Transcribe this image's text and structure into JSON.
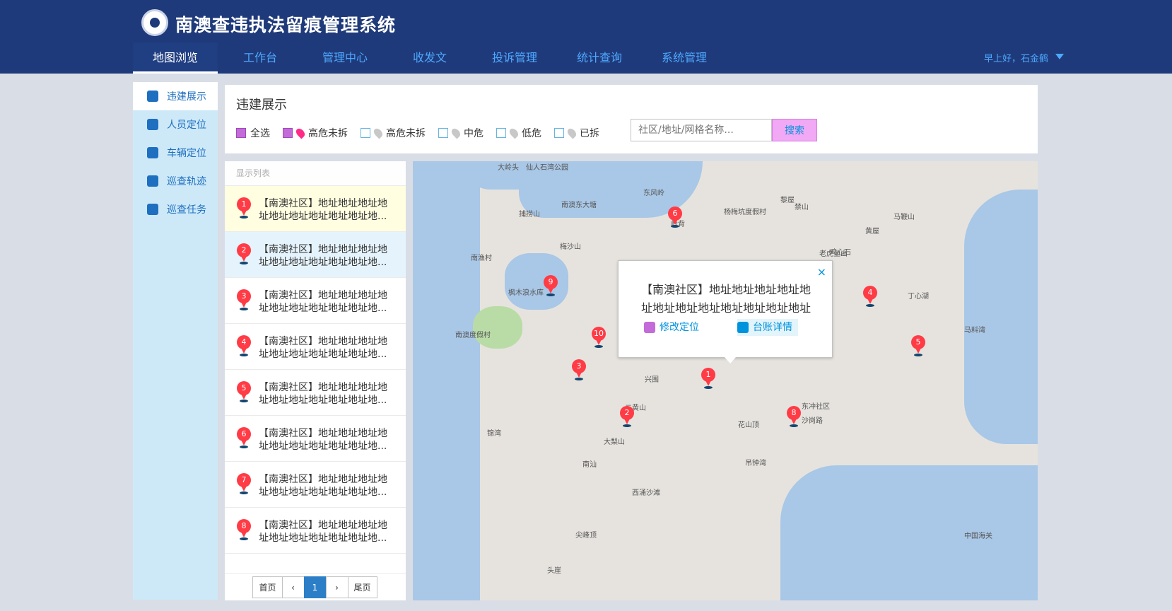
{
  "header": {
    "title": "南澳查违执法留痕管理系统",
    "nav": [
      "地图浏览",
      "工作台",
      "管理中心",
      "收发文",
      "投诉管理",
      "统计查询",
      "系统管理"
    ],
    "active_nav": "地图浏览",
    "user": "早上好，石金鹤"
  },
  "sidebar": {
    "items": [
      {
        "label": "违建展示",
        "icon": "building-icon"
      },
      {
        "label": "人员定位",
        "icon": "person-icon"
      },
      {
        "label": "车辆定位",
        "icon": "car-icon"
      },
      {
        "label": "巡查轨迹",
        "icon": "route-icon"
      },
      {
        "label": "巡查任务",
        "icon": "task-icon"
      }
    ]
  },
  "panel": {
    "title": "违建展示",
    "filters": [
      "全选",
      "高危未拆",
      "高危未拆",
      "中危",
      "低危",
      "已拆"
    ],
    "search_placeholder": "社区/地址/网格名称...",
    "search_button": "搜索"
  },
  "list": {
    "header": "显示列表",
    "items": [
      {
        "num": "1",
        "text": "【南澳社区】地址地址地址地址地址地址地址地址地址地..."
      },
      {
        "num": "2",
        "text": "【南澳社区】地址地址地址地址地址地址地址地址地址地..."
      },
      {
        "num": "3",
        "text": "【南澳社区】地址地址地址地址地址地址地址地址地址地..."
      },
      {
        "num": "4",
        "text": "【南澳社区】地址地址地址地址地址地址地址地址地址地..."
      },
      {
        "num": "5",
        "text": "【南澳社区】地址地址地址地址地址地址地址地址地址地..."
      },
      {
        "num": "6",
        "text": "【南澳社区】地址地址地址地址地址地址地址地址地址地..."
      },
      {
        "num": "7",
        "text": "【南澳社区】地址地址地址地址地址地址地址地址地址地..."
      },
      {
        "num": "8",
        "text": "【南澳社区】地址地址地址地址地址地址地址地址地址地..."
      }
    ],
    "pagination": {
      "first": "首页",
      "prev": "‹",
      "current": "1",
      "next": "›",
      "last": "尾页"
    }
  },
  "map": {
    "labels": [
      "大岭头",
      "仙人石湾公园",
      "东风岭",
      "南澳东大塘",
      "杨梅坑度假村",
      "黎屋",
      "禁山",
      "捕捞山",
      "马鞭山",
      "黄屋",
      "岭背",
      "枫木浪水库",
      "南渔村",
      "梅沙山",
      "鸡心石",
      "老虎坐山",
      "丁心湖",
      "马料湾",
      "南澳度假村",
      "兴围",
      "东冲社区",
      "沙岗路",
      "二黄山",
      "花山顶",
      "锦湾",
      "大梨山",
      "西涌沙滩",
      "吊钟湾",
      "南汕",
      "尖峰顶",
      "头崖",
      "中国海关"
    ],
    "popup": {
      "text": "【南澳社区】地址地址地址地址地址地址地址地址地址地址地址地址",
      "locate": "修改定位",
      "detail": "台账详情"
    },
    "markers": [
      "6",
      "9",
      "4",
      "10",
      "3",
      "1",
      "2",
      "8",
      "5"
    ]
  },
  "colors": {
    "primary": "#1f3a7a",
    "accent": "#0093dd",
    "text": "#343434",
    "hover": "#fffee0",
    "active": "#e5f3fc",
    "border": "#c2c2c2"
  }
}
